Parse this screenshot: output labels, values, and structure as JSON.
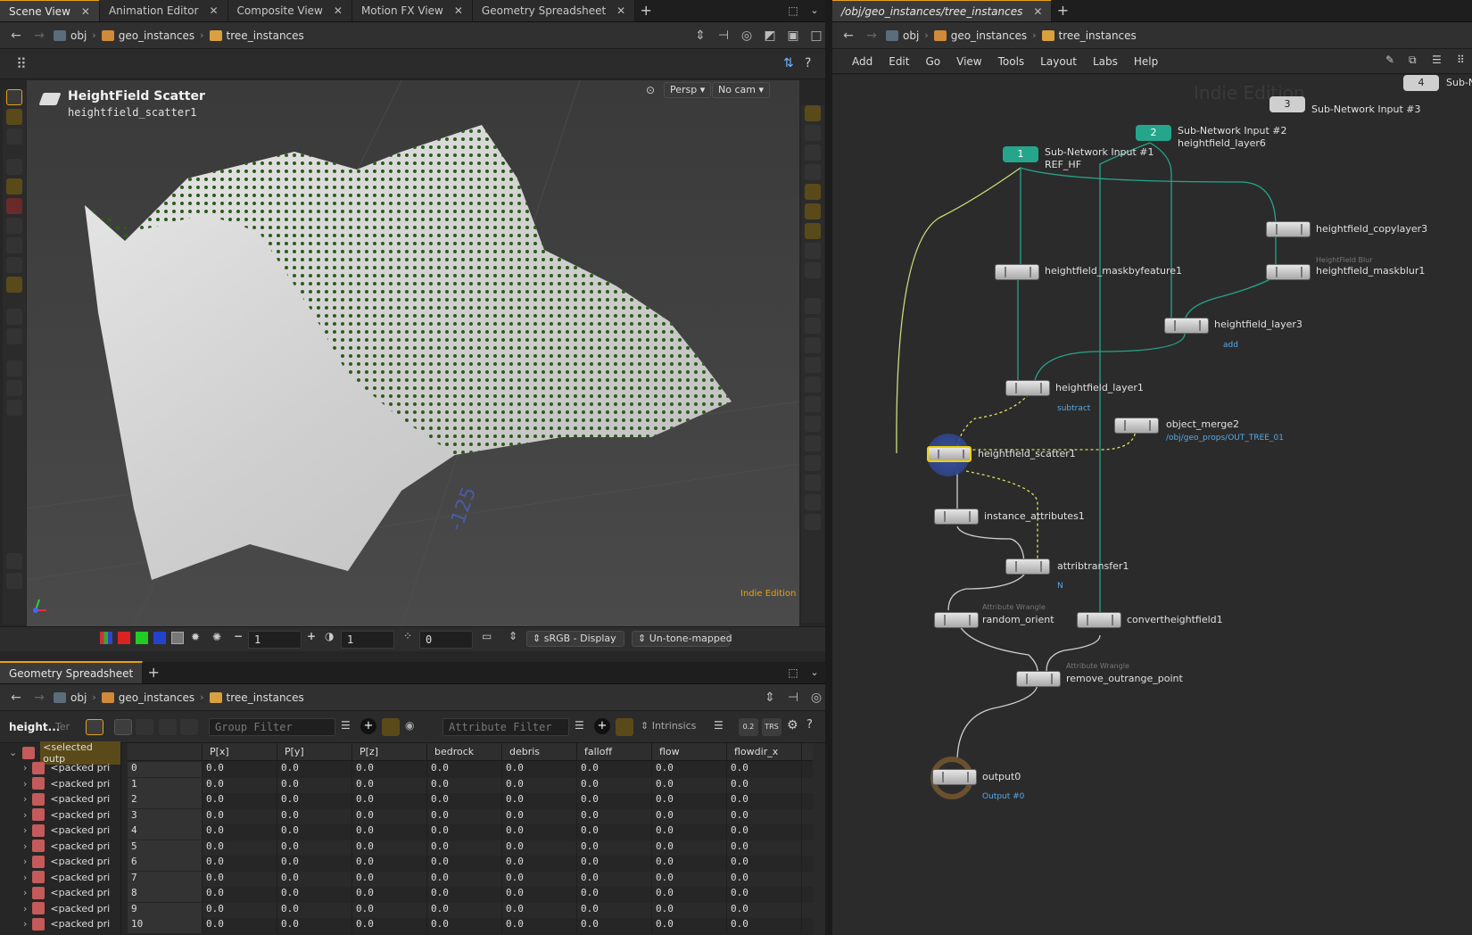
{
  "colors": {
    "accent": "#e6a117",
    "node_wire": "#25a58c",
    "wire_yellow": "#e0e05a",
    "sub_label": "#5aa9e6",
    "flag_green": "#8bd14d"
  },
  "left_tabs": [
    {
      "label": "Scene View",
      "active": true
    },
    {
      "label": "Animation Editor"
    },
    {
      "label": "Composite View"
    },
    {
      "label": "Motion FX View"
    },
    {
      "label": "Geometry Spreadsheet"
    }
  ],
  "right_tab": {
    "label": "/obj/geo_instances/tree_instances"
  },
  "path": {
    "obj": "obj",
    "geo": "geo_instances",
    "tree": "tree_instances"
  },
  "viewport": {
    "title": "HeightField Scatter",
    "subtitle": "heightfield_scatter1",
    "persp": "Persp",
    "cam": "No cam",
    "edition": "Indie Edition",
    "axis_label": "-125"
  },
  "viewbar": {
    "v1": "1",
    "v2": "1",
    "v3": "0",
    "display": "sRGB - Display",
    "tone": "Un-tone-mapped"
  },
  "menu": [
    "Add",
    "Edit",
    "Go",
    "View",
    "Tools",
    "Layout",
    "Labs",
    "Help"
  ],
  "net": {
    "watermark": "Indie Edition",
    "in1_num": "1",
    "in1_label": "Sub-Network Input #1",
    "in1_sub": "REF_HF",
    "in2_num": "2",
    "in2_label": "Sub-Network Input #2",
    "in2_sub": "heightfield_layer6",
    "in3_num": "3",
    "in3_label": "Sub-Network Input #3",
    "in4_num": "4",
    "in4_label": "Sub-N",
    "copylayer": "heightfield_copylayer3",
    "maskblur_hint": "HeightField Blur",
    "maskblur": "heightfield_maskblur1",
    "maskbyfeature": "heightfield_maskbyfeature1",
    "layer3": "heightfield_layer3",
    "layer3_sub": "add",
    "layer1": "heightfield_layer1",
    "layer1_sub": "subtract",
    "objmerge": "object_merge2",
    "objmerge_sub": "/obj/geo_props/OUT_TREE_01",
    "scatter": "heightfield_scatter1",
    "instattr": "instance_attributes1",
    "attribtransfer": "attribtransfer1",
    "attribtransfer_sub": "N",
    "randorient_hint": "Attribute Wrangle",
    "randorient": "random_orient",
    "convert": "convertheightfield1",
    "remove_hint": "Attribute Wrangle",
    "remove": "remove_outrange_point",
    "output": "output0",
    "output_sub": "Output #0"
  },
  "sheet": {
    "tab": "Geometry Spreadsheet",
    "node_short": "height...",
    "ter": "Ter",
    "group_placeholder": "Group Filter",
    "attr_placeholder": "Attribute Filter",
    "intrinsics": "Intrinsics",
    "tree_root": "<selected outp",
    "tree_item": "<packed pri",
    "columns": [
      "P[x]",
      "P[y]",
      "P[z]",
      "bedrock",
      "debris",
      "falloff",
      "flow",
      "flowdir_x"
    ],
    "rows": [
      "0",
      "1",
      "2",
      "3",
      "4",
      "5",
      "6",
      "7",
      "8",
      "9",
      "10"
    ],
    "cell": "0.0"
  }
}
